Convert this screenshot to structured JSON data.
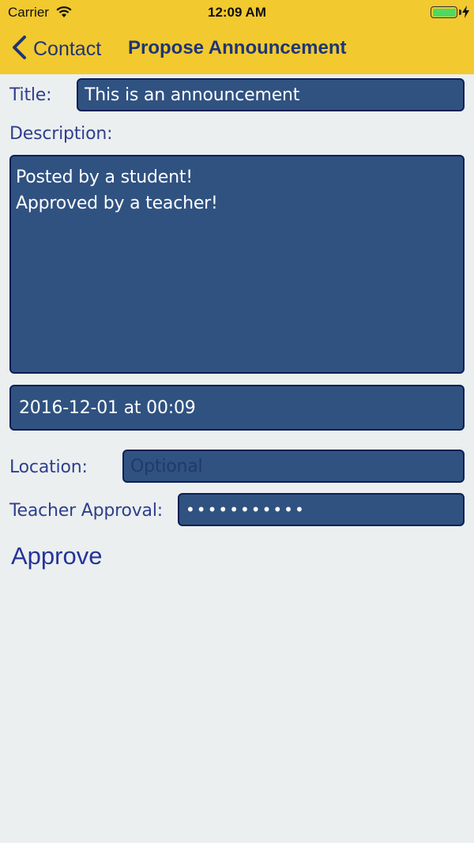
{
  "status_bar": {
    "carrier": "Carrier",
    "time": "12:09 AM",
    "wifi_icon": "wifi-icon",
    "battery_icon": "battery-charging-icon"
  },
  "nav": {
    "back_label": "Contact",
    "back_icon": "chevron-left-icon",
    "title": "Propose Announcement"
  },
  "form": {
    "title_label": "Title:",
    "title_value": "This is an announcement",
    "description_label": "Description:",
    "description_value": "Posted by a student!\nApproved by a teacher!",
    "date_value": "2016-12-01 at 00:09",
    "location_label": "Location:",
    "location_value": "",
    "location_placeholder": "Optional",
    "teacher_approval_label": "Teacher Approval:",
    "teacher_approval_value": "abcdefghijk"
  },
  "actions": {
    "approve_label": "Approve"
  },
  "colors": {
    "nav_background": "#f2c92f",
    "nav_text": "#1f3575",
    "page_background": "#ebeff0",
    "field_background": "#305281",
    "field_border": "#0d1f55",
    "label_text": "#2f3f8c",
    "approve_text": "#25349a"
  }
}
